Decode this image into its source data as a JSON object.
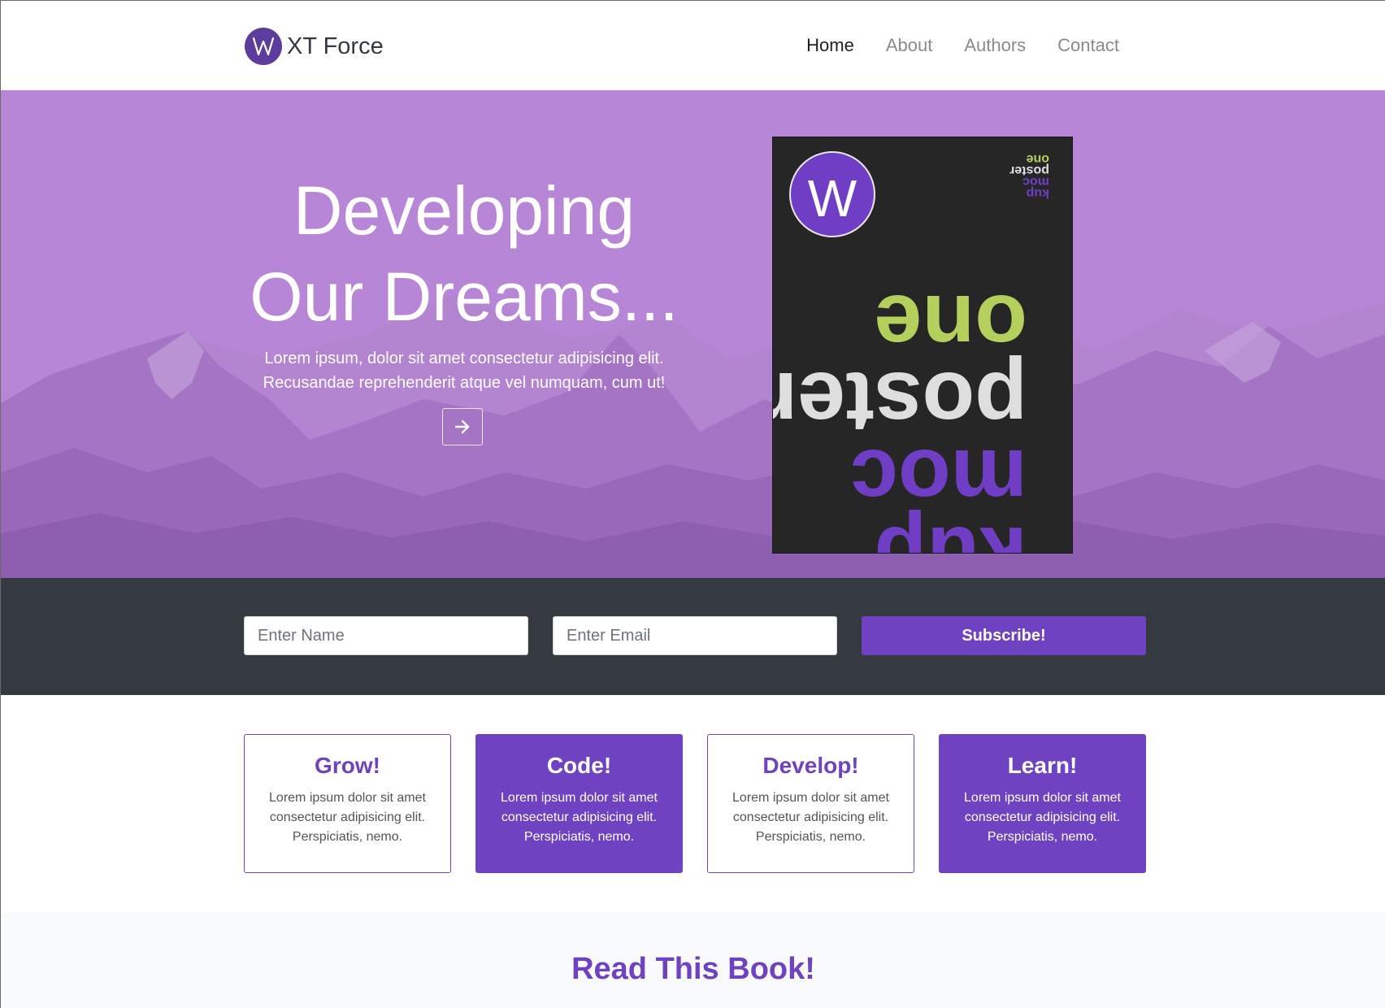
{
  "brand": {
    "name": "XT Force",
    "logo_icon": "w-logo-icon"
  },
  "nav": {
    "items": [
      {
        "label": "Home",
        "active": true
      },
      {
        "label": "About",
        "active": false
      },
      {
        "label": "Authors",
        "active": false
      },
      {
        "label": "Contact",
        "active": false
      }
    ]
  },
  "hero": {
    "title_line1": "Developing",
    "title_line2": "Our Dreams...",
    "text_line1": "Lorem ipsum, dolor sit amet consectetur adipisicing elit.",
    "text_line2": "Recusandae reprehenderit atque vel numquam, cum ut!",
    "button_icon": "arrow-right-icon",
    "poster": {
      "logo_letter": "W",
      "small_lines": [
        "kup",
        "moc",
        "poster",
        "one"
      ],
      "big_lines": [
        "kup",
        "moc",
        "poster",
        "one"
      ]
    }
  },
  "subscribe": {
    "name_placeholder": "Enter Name",
    "email_placeholder": "Enter Email",
    "button_label": "Subscribe!"
  },
  "features": [
    {
      "title": "Grow!",
      "text": "Lorem ipsum dolor sit amet consectetur adipisicing elit. Perspiciatis, nemo.",
      "filled": false
    },
    {
      "title": "Code!",
      "text": "Lorem ipsum dolor sit amet consectetur adipisicing elit. Perspiciatis, nemo.",
      "filled": true
    },
    {
      "title": "Develop!",
      "text": "Lorem ipsum dolor sit amet consectetur adipisicing elit. Perspiciatis, nemo.",
      "filled": false
    },
    {
      "title": "Learn!",
      "text": "Lorem ipsum dolor sit amet consectetur adipisicing elit. Perspiciatis, nemo.",
      "filled": true
    }
  ],
  "read_section": {
    "title": "Read This Book!"
  },
  "colors": {
    "primary": "#6f42c1",
    "hero_bg": "#b886d6",
    "dark": "#343a40",
    "poster_bg": "#262626",
    "poster_green": "#b5cf5d",
    "poster_purple": "#6f3ec4",
    "poster_white": "#dedede"
  }
}
